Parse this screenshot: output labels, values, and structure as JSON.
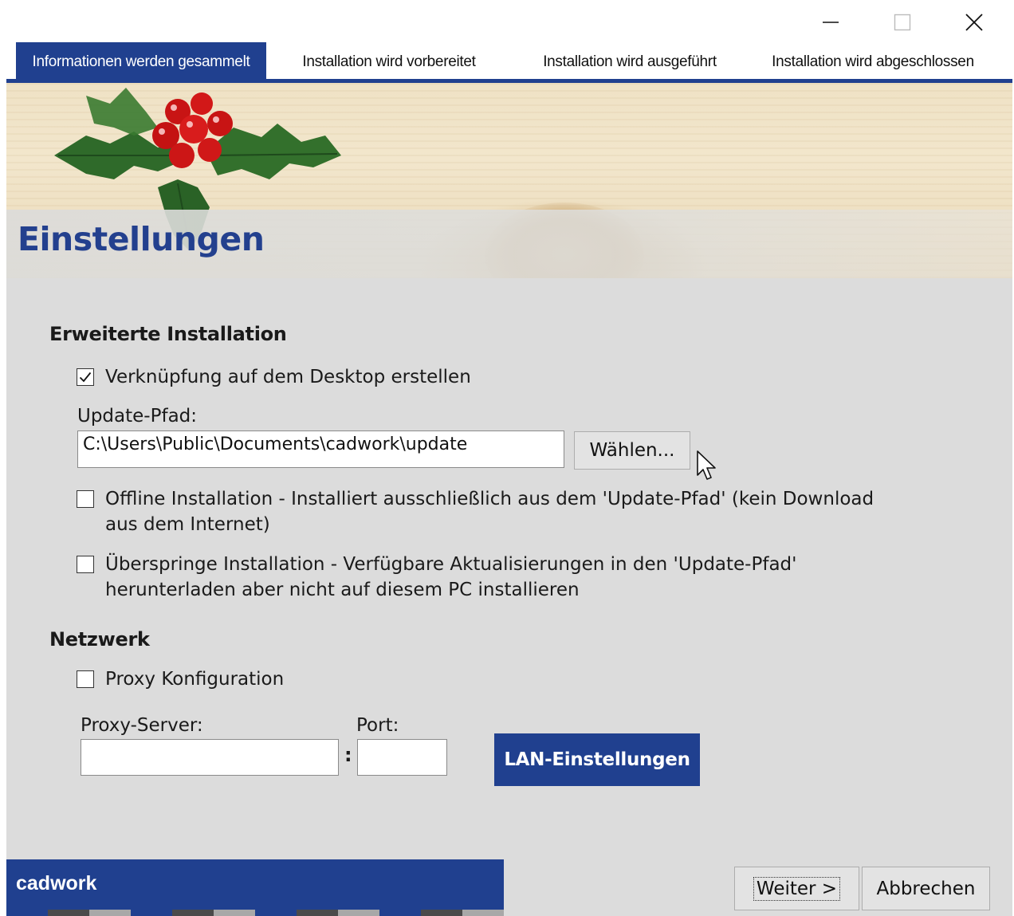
{
  "window": {
    "minimize_icon": "minimize-icon",
    "maximize_icon": "maximize-icon",
    "close_icon": "close-icon"
  },
  "tabs": [
    {
      "label": "Informationen werden gesammelt",
      "active": true
    },
    {
      "label": "Installation wird vorbereitet",
      "active": false
    },
    {
      "label": "Installation wird ausgeführt",
      "active": false
    },
    {
      "label": "Installation wird abgeschlossen",
      "active": false
    }
  ],
  "header": {
    "title": "Einstellungen"
  },
  "advanced": {
    "heading": "Erweiterte Installation",
    "desktop_shortcut": {
      "label": "Verknüpfung auf dem Desktop erstellen",
      "checked": true
    },
    "update_path_label": "Update-Pfad:",
    "update_path_value": "C:\\Users\\Public\\Documents\\cadwork\\update",
    "choose_button": "Wählen...",
    "offline": {
      "line1": "Offline Installation - Installiert ausschließlich aus dem 'Update-Pfad' (kein Download",
      "line2": "aus dem Internet)",
      "checked": false
    },
    "skip": {
      "line1": "Überspringe Installation - Verfügbare Aktualisierungen in den 'Update-Pfad'",
      "line2": "herunterladen aber nicht auf diesem PC installieren",
      "checked": false
    }
  },
  "network": {
    "heading": "Netzwerk",
    "proxy_config": {
      "label": "Proxy Konfiguration",
      "checked": false
    },
    "proxy_server_label": "Proxy-Server:",
    "proxy_server_value": "",
    "port_label": "Port:",
    "port_value": "",
    "colon": ":",
    "lan_button": "LAN-Einstellungen"
  },
  "footer": {
    "brand": "cadwork",
    "next_button": "Weiter >",
    "cancel_button": "Abbrechen"
  },
  "colors": {
    "accent": "#20408f",
    "content_bg": "#dcdcdc"
  }
}
